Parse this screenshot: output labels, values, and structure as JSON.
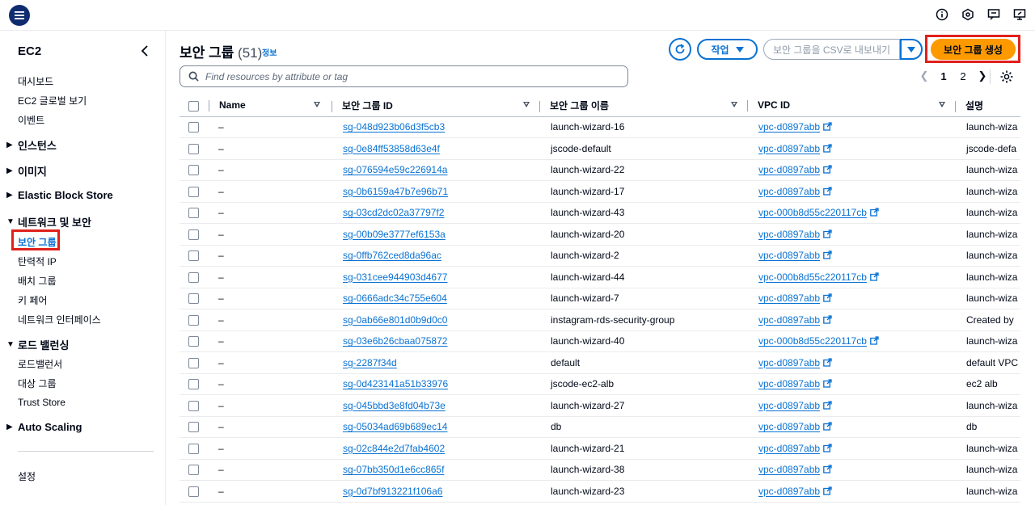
{
  "topbar": {
    "icons": [
      "menu-icon",
      "info-icon",
      "settings-hex-icon",
      "feedback-icon",
      "desktop-icon"
    ]
  },
  "sidebar": {
    "title": "EC2",
    "links_top": [
      "대시보드",
      "EC2 글로벌 보기",
      "이벤트"
    ],
    "sections": [
      {
        "label": "인스턴스",
        "expanded": false
      },
      {
        "label": "이미지",
        "expanded": false
      },
      {
        "label": "Elastic Block Store",
        "expanded": false
      },
      {
        "label": "네트워크 및 보안",
        "expanded": true
      },
      {
        "label": "로드 밸런싱",
        "expanded": true
      },
      {
        "label": "Auto Scaling",
        "expanded": false
      }
    ],
    "network_items": [
      "보안 그룹",
      "탄력적 IP",
      "배치 그룹",
      "키 페어",
      "네트워크 인터페이스"
    ],
    "lb_items": [
      "로드밸런서",
      "대상 그룹",
      "Trust Store"
    ],
    "footer": "설정"
  },
  "header": {
    "title": "보안 그룹",
    "count": "(51)",
    "info": "정보",
    "actions_label": "작업",
    "export_label": "보안 그룹을 CSV로 내보내기",
    "create_label": "보안 그룹 생성"
  },
  "search": {
    "placeholder": "Find resources by attribute or tag"
  },
  "pagination": {
    "pages": [
      "1",
      "2"
    ],
    "current": "1"
  },
  "table": {
    "columns": [
      "Name",
      "보안 그룹 ID",
      "보안 그룹 이름",
      "VPC ID",
      "설명"
    ],
    "rows": [
      {
        "name": "–",
        "sg_id": "sg-048d923b06d3f5cb3",
        "sg_name": "launch-wizard-16",
        "vpc": "vpc-d0897abb",
        "desc": "launch-wiza"
      },
      {
        "name": "–",
        "sg_id": "sg-0e84ff53858d63e4f",
        "sg_name": "jscode-default",
        "vpc": "vpc-d0897abb",
        "desc": "jscode-defa"
      },
      {
        "name": "–",
        "sg_id": "sg-076594e59c226914a",
        "sg_name": "launch-wizard-22",
        "vpc": "vpc-d0897abb",
        "desc": "launch-wiza"
      },
      {
        "name": "–",
        "sg_id": "sg-0b6159a47b7e96b71",
        "sg_name": "launch-wizard-17",
        "vpc": "vpc-d0897abb",
        "desc": "launch-wiza"
      },
      {
        "name": "–",
        "sg_id": "sg-03cd2dc02a37797f2",
        "sg_name": "launch-wizard-43",
        "vpc": "vpc-000b8d55c220117cb",
        "desc": "launch-wiza"
      },
      {
        "name": "–",
        "sg_id": "sg-00b09e3777ef6153a",
        "sg_name": "launch-wizard-20",
        "vpc": "vpc-d0897abb",
        "desc": "launch-wiza"
      },
      {
        "name": "–",
        "sg_id": "sg-0ffb762ced8da96ac",
        "sg_name": "launch-wizard-2",
        "vpc": "vpc-d0897abb",
        "desc": "launch-wiza"
      },
      {
        "name": "–",
        "sg_id": "sg-031cee944903d4677",
        "sg_name": "launch-wizard-44",
        "vpc": "vpc-000b8d55c220117cb",
        "desc": "launch-wiza"
      },
      {
        "name": "–",
        "sg_id": "sg-0666adc34c755e604",
        "sg_name": "launch-wizard-7",
        "vpc": "vpc-d0897abb",
        "desc": "launch-wiza"
      },
      {
        "name": "–",
        "sg_id": "sg-0ab66e801d0b9d0c0",
        "sg_name": "instagram-rds-security-group",
        "vpc": "vpc-d0897abb",
        "desc": "Created by"
      },
      {
        "name": "–",
        "sg_id": "sg-03e6b26cbaa075872",
        "sg_name": "launch-wizard-40",
        "vpc": "vpc-000b8d55c220117cb",
        "desc": "launch-wiza"
      },
      {
        "name": "–",
        "sg_id": "sg-2287f34d",
        "sg_name": "default",
        "vpc": "vpc-d0897abb",
        "desc": "default VPC"
      },
      {
        "name": "–",
        "sg_id": "sg-0d423141a51b33976",
        "sg_name": "jscode-ec2-alb",
        "vpc": "vpc-d0897abb",
        "desc": "ec2 alb"
      },
      {
        "name": "–",
        "sg_id": "sg-045bbd3e8fd04b73e",
        "sg_name": "launch-wizard-27",
        "vpc": "vpc-d0897abb",
        "desc": "launch-wiza"
      },
      {
        "name": "–",
        "sg_id": "sg-05034ad69b689ec14",
        "sg_name": "db",
        "vpc": "vpc-d0897abb",
        "desc": "db"
      },
      {
        "name": "–",
        "sg_id": "sg-02c844e2d7fab4602",
        "sg_name": "launch-wizard-21",
        "vpc": "vpc-d0897abb",
        "desc": "launch-wiza"
      },
      {
        "name": "–",
        "sg_id": "sg-07bb350d1e6cc865f",
        "sg_name": "launch-wizard-38",
        "vpc": "vpc-d0897abb",
        "desc": "launch-wiza"
      },
      {
        "name": "–",
        "sg_id": "sg-0d7bf913221f106a6",
        "sg_name": "launch-wizard-23",
        "vpc": "vpc-d0897abb",
        "desc": "launch-wiza"
      }
    ]
  },
  "colors": {
    "link": "#0972d3",
    "primary": "#ff9900",
    "highlight": "#e0201b",
    "menu_bg": "#0f2c6f"
  }
}
